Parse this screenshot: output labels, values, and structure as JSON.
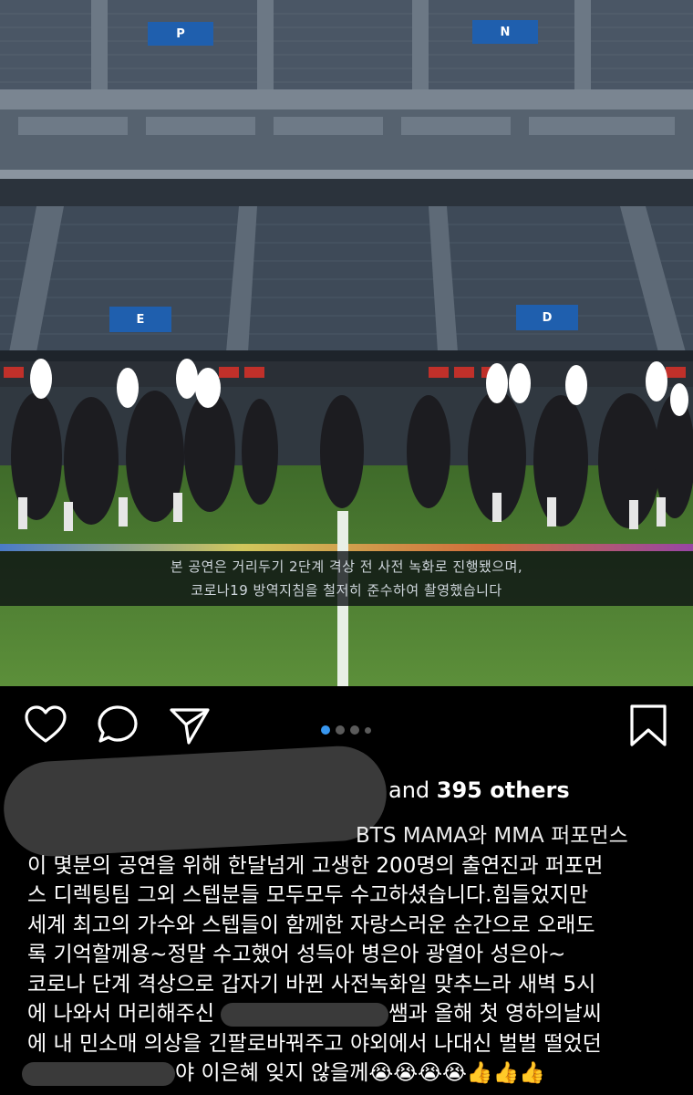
{
  "photo": {
    "caption_line1": "본 공연은 거리두기 2단계 격상 전 사전 녹화로 진행됐으며,",
    "caption_line2": "코로나19 방역지침을 철저히 준수하여 촬영했습니다",
    "signs": [
      "P",
      "N",
      "E",
      "D"
    ]
  },
  "actions": {
    "like_icon": "heart-icon",
    "comment_icon": "comment-icon",
    "share_icon": "paper-plane-icon",
    "save_icon": "bookmark-icon",
    "carousel_count": 4,
    "carousel_active": 0
  },
  "likes": {
    "prefix": "and ",
    "count_text": "395 others"
  },
  "post": {
    "line1_tail": "BTS MAMA와 MMA 퍼포먼스",
    "line2": "이 몇분의 공연을 위해 한달넘게 고생한 200명의 출연진과 퍼포먼",
    "line3": "스 디렉팅팀 그외 스텝분들 모두모두 수고하셨습니다.힘들었지만",
    "line4": "세계 최고의 가수와 스텝들이 함께한 자랑스러운 순간으로 오래도",
    "line5": "록 기억할께용~정말 수고했어 성득아 병은아 광열아 성은아~",
    "line6": "코로나 단계 격상으로 갑자기 바뀐 사전녹화일 맞추느라 새벽 5시",
    "line7_start": "에 나와서 머리해주신 ",
    "line7_end": "쌤과 올해 첫 영하의날씨",
    "line8": "에 내 민소매 의상을 긴팔로바꿔주고 야외에서 나대신 벌벌 떨었던",
    "line9_end": "야 이은혜 잊지 않을께",
    "emojis": "😭😭😭😭👍👍👍"
  },
  "colors": {
    "background": "#000000",
    "accent": "#3897f0",
    "redaction": "#3a3a3a"
  }
}
